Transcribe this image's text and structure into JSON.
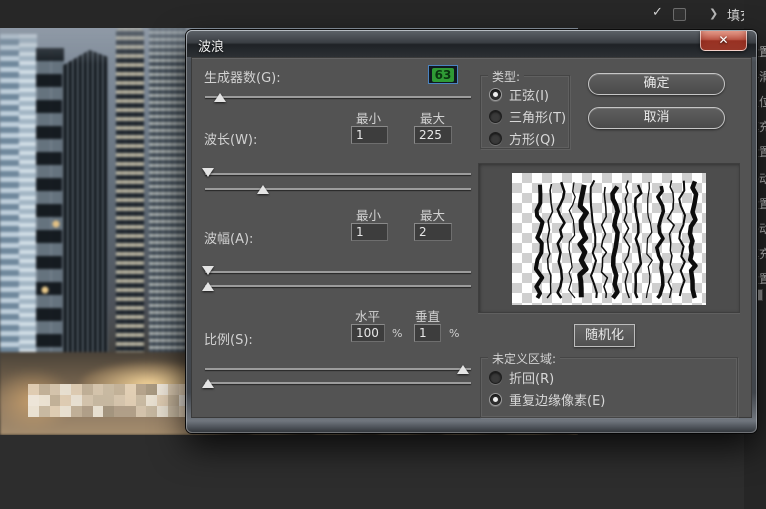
{
  "window": {
    "title": "波浪",
    "close_glyph": "✕"
  },
  "topbar": {
    "check_glyph": "✓",
    "chevron_glyph": "❯",
    "fill_label": "填充"
  },
  "history": {
    "items": [
      "设置",
      "平滑",
      "复位",
      "填充",
      "设置",
      "移动",
      "设置",
      "移动",
      "填充",
      "设置"
    ]
  },
  "dialog": {
    "generators": {
      "label": "生成器数(G):",
      "value": "63"
    },
    "wavelength": {
      "label": "波长(W):",
      "min_label": "最小",
      "max_label": "最大",
      "min_value": "1",
      "max_value": "225"
    },
    "amplitude": {
      "label": "波幅(A):",
      "min_label": "最小",
      "max_label": "最大",
      "min_value": "1",
      "max_value": "2"
    },
    "scale": {
      "label": "比例(S):",
      "h_label": "水平",
      "v_label": "垂直",
      "h_value": "100",
      "v_value": "1",
      "percent": "%"
    },
    "type_group": {
      "legend": "类型:",
      "options": [
        {
          "label": "正弦(I)"
        },
        {
          "label": "三角形(T)"
        },
        {
          "label": "方形(Q)"
        }
      ],
      "selected_index": 0
    },
    "undefined_group": {
      "legend": "未定义区域:",
      "options": [
        {
          "label": "折回(R)"
        },
        {
          "label": "重复边缘像素(E)"
        }
      ],
      "selected_index": 1
    },
    "buttons": {
      "ok": "确定",
      "cancel": "取消",
      "randomize": "随机化"
    }
  },
  "colors": {
    "dialog_bg": "#535353",
    "focus_border": "#4a83c0",
    "value_selection_green": "#2f9a35",
    "close_button_red": "#b0493c",
    "titlebar_dark": "#25282c"
  }
}
